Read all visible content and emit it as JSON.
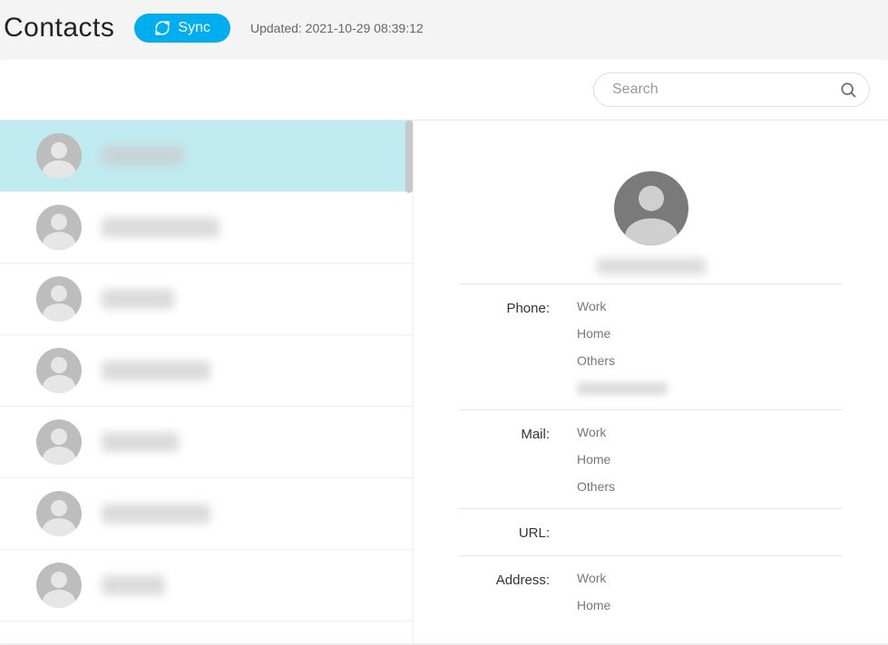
{
  "header": {
    "title": "Contacts",
    "sync_label": "Sync",
    "updated_text": "Updated: 2021-10-29 08:39:12"
  },
  "search": {
    "placeholder": "Search"
  },
  "contacts": [
    {
      "name_width": 90,
      "selected": true
    },
    {
      "name_width": 130,
      "selected": false
    },
    {
      "name_width": 80,
      "selected": false
    },
    {
      "name_width": 120,
      "selected": false
    },
    {
      "name_width": 85,
      "selected": false
    },
    {
      "name_width": 120,
      "selected": false
    },
    {
      "name_width": 70,
      "selected": false
    }
  ],
  "detail": {
    "sections": [
      {
        "label": "Phone:",
        "rows": [
          {
            "text": "Work"
          },
          {
            "text": "Home"
          },
          {
            "text": "Others"
          },
          {
            "blur": true
          }
        ]
      },
      {
        "label": "Mail:",
        "rows": [
          {
            "text": "Work"
          },
          {
            "text": "Home"
          },
          {
            "text": "Others"
          }
        ]
      },
      {
        "label": "URL:",
        "rows": []
      },
      {
        "label": "Address:",
        "rows": [
          {
            "text": "Work"
          },
          {
            "text": "Home"
          }
        ]
      }
    ]
  }
}
